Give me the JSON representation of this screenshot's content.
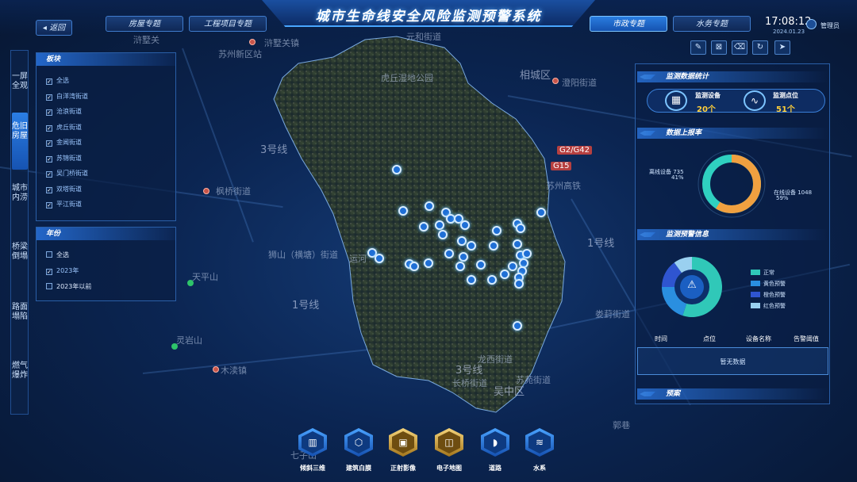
{
  "header": {
    "title": "城市生命线安全风险监测预警系统",
    "back_label": "返回",
    "tabs": [
      {
        "label": "房屋专题",
        "active": false
      },
      {
        "label": "工程项目专题",
        "active": false
      },
      {
        "label": "市政专题",
        "active": true
      },
      {
        "label": "水务专题",
        "active": false
      }
    ],
    "time": "17:08:12",
    "date": "2024.01.23",
    "user": "管理员",
    "tools": [
      "ruler-icon",
      "area-icon",
      "clear-icon",
      "refresh-icon",
      "pointer-icon"
    ]
  },
  "left_nav": [
    {
      "label": "一屏全观",
      "active": false
    },
    {
      "label": "危旧房屋",
      "active": true
    },
    {
      "label": "城市内涝",
      "active": false
    },
    {
      "label": "桥梁倒塌",
      "active": false
    },
    {
      "label": "路面塌陷",
      "active": false
    },
    {
      "label": "燃气爆炸",
      "active": false
    }
  ],
  "block_panel": {
    "title": "板块",
    "items": [
      {
        "label": "全选",
        "checked": true
      },
      {
        "label": "白洋湾街道",
        "checked": true
      },
      {
        "label": "沧浪街道",
        "checked": true
      },
      {
        "label": "虎丘街道",
        "checked": true
      },
      {
        "label": "金阊街道",
        "checked": true
      },
      {
        "label": "苏锦街道",
        "checked": true
      },
      {
        "label": "吴门桥街道",
        "checked": true
      },
      {
        "label": "双塔街道",
        "checked": true
      },
      {
        "label": "平江街道",
        "checked": true
      }
    ]
  },
  "year_panel": {
    "title": "年份",
    "items": [
      {
        "label": "全选",
        "checked": false
      },
      {
        "label": "2023年",
        "checked": true
      },
      {
        "label": "2023年以前",
        "checked": false
      }
    ]
  },
  "map": {
    "labels": [
      "浒墅关镇",
      "苏州新区站",
      "浒墅关",
      "元和街道",
      "虎丘湿地公园",
      "相城区",
      "澄阳街道",
      "3号线",
      "G2/G42",
      "G15",
      "枫桥街道",
      "1号线",
      "狮山（横塘）街道",
      "天平山",
      "1号线",
      "灵岩山",
      "木渎镇",
      "龙西街道",
      "苏苑街道",
      "3号线",
      "长桥街道",
      "吴中区",
      "娄葑街道",
      "郭巷",
      "苏州高铁",
      "运河",
      "七子山"
    ],
    "marker_count": 38
  },
  "stats": {
    "title": "监测数据统计",
    "devices_label": "监测设备",
    "devices_value": "20个",
    "points_label": "监测点位",
    "points_value": "51个"
  },
  "online": {
    "title": "数据上报率",
    "offline_label": "离线设备 735",
    "offline_pct": "41%",
    "online_label": "在线设备 1048",
    "online_pct": "59%",
    "online_ratio": 0.59,
    "colors": {
      "online": "#f0a040",
      "offline": "#2fd0c0"
    }
  },
  "alerts": {
    "title": "监测预警信息",
    "legend": [
      {
        "label": "正常",
        "color": "#30c8b8",
        "value": 0.55
      },
      {
        "label": "黄色预警",
        "color": "#2a8fe0",
        "value": 0.2
      },
      {
        "label": "橙色预警",
        "color": "#2f55d0",
        "value": 0.15
      },
      {
        "label": "红色预警",
        "color": "#9ad0f0",
        "value": 0.1
      }
    ],
    "columns": [
      "时间",
      "点位",
      "设备名称",
      "告警阈值"
    ],
    "empty_text": "暂无数据"
  },
  "plan": {
    "title": "预案"
  },
  "dock": [
    {
      "label": "倾斜三维",
      "icon": "building-3d-icon",
      "gold": false
    },
    {
      "label": "建筑白膜",
      "icon": "cube-icon",
      "gold": false
    },
    {
      "label": "正射影像",
      "icon": "image-icon",
      "gold": true
    },
    {
      "label": "电子地图",
      "icon": "map-icon",
      "gold": true
    },
    {
      "label": "道路",
      "icon": "road-icon",
      "gold": false
    },
    {
      "label": "水系",
      "icon": "water-icon",
      "gold": false
    }
  ]
}
